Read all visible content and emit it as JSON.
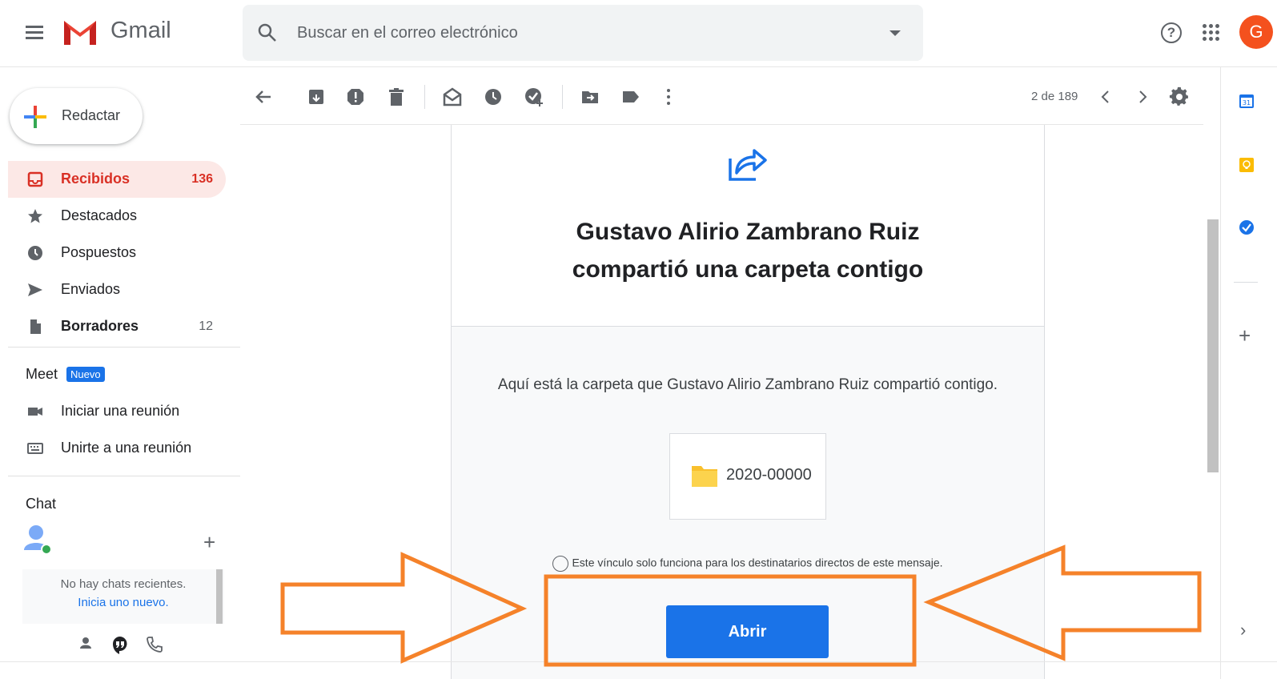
{
  "app": {
    "brand": "Gmail",
    "avatar_letter": "G"
  },
  "search": {
    "placeholder": "Buscar en el correo electrónico"
  },
  "compose": {
    "label": "Redactar"
  },
  "sidebar": {
    "items": [
      {
        "label": "Recibidos",
        "count": "136"
      },
      {
        "label": "Destacados",
        "count": ""
      },
      {
        "label": "Pospuestos",
        "count": ""
      },
      {
        "label": "Enviados",
        "count": ""
      },
      {
        "label": "Borradores",
        "count": "12"
      }
    ],
    "meet": {
      "title": "Meet",
      "badge": "Nuevo",
      "start": "Iniciar una reunión",
      "join": "Unirte a una reunión"
    },
    "chat": {
      "title": "Chat",
      "add": "+",
      "empty": "No hay chats recientes.",
      "start_new": "Inicia uno nuevo."
    }
  },
  "toolbar": {
    "pager": "2 de 189"
  },
  "email": {
    "headline_line1": "Gustavo Alirio Zambrano Ruiz",
    "headline_line2": "compartió una carpeta contigo",
    "body": "Aquí está la carpeta que Gustavo Alirio Zambrano Ruiz compartió contigo.",
    "folder_name": "2020-00000",
    "note": "Este vínculo solo funciona para los destinatarios directos de este mensaje.",
    "open_button": "Abrir"
  },
  "addons": {
    "add": "+",
    "expand": "›"
  },
  "colors": {
    "accent": "#1a73e8",
    "inbox_active": "#d93025",
    "annotation": "#f5822a",
    "avatar": "#f4511e"
  }
}
